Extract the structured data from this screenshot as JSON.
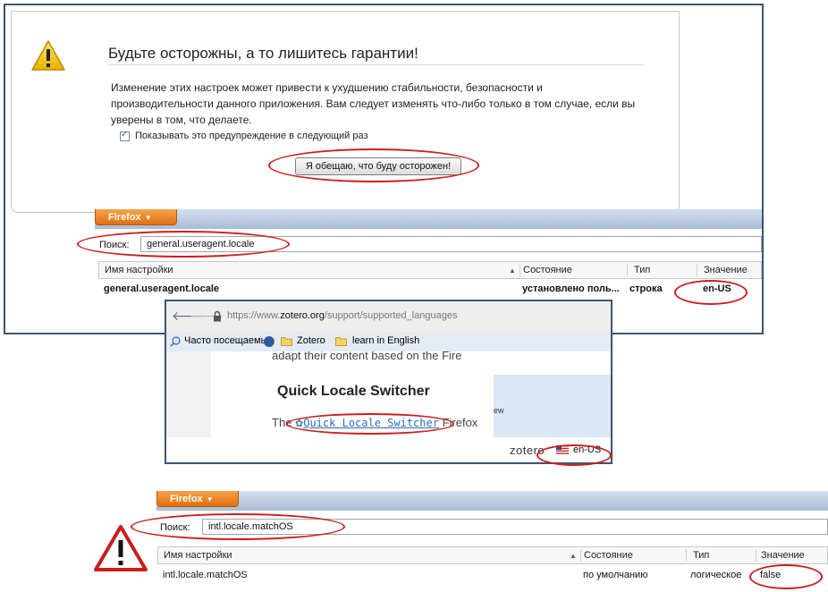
{
  "warning": {
    "title": "Будьте осторожны, а то лишитесь гарантии!",
    "text": "Изменение этих настроек может привести к ухудшению стабильности, безопасности и производительности данного приложения. Вам следует изменять что-либо только в том случае, если вы уверены в том, что делаете.",
    "checkbox_label": "Показывать это предупреждение в следующий раз",
    "checkbox_checked": true,
    "promise_button": "Я обещаю, что буду осторожен!"
  },
  "prefs_top": {
    "app_button": "Firefox",
    "search_label": "Поиск:",
    "search_value": "general.useragent.locale",
    "columns": [
      "Имя настройки",
      "Состояние",
      "Тип",
      "Значение"
    ],
    "row": {
      "name": "general.useragent.locale",
      "status": "установлено поль...",
      "type": "строка",
      "value": "en-US"
    }
  },
  "browser": {
    "url_prefix": "https://www.",
    "url_domain": "zotero.org",
    "url_path": "/support/supported_languages",
    "bookmarks": [
      "Часто посещаемые",
      "Zotero",
      "learn in English"
    ],
    "cut_text_top": "adapt their content based on the Fire",
    "heading": "Quick Locale Switcher",
    "para_start": "The ",
    "link_text": "Quick Locale Switcher",
    "para_end": " Firefox",
    "side_text": "ew",
    "status_brand": "zotero",
    "status_locale": "en-US"
  },
  "prefs_bottom": {
    "app_button": "Firefox",
    "search_label": "Поиск:",
    "search_value": "intl.locale.matchOS",
    "columns": [
      "Имя настройки",
      "Состояние",
      "Тип",
      "Значение"
    ],
    "row": {
      "name": "intl.locale.matchOS",
      "status": "по умолчанию",
      "type": "логическое",
      "value": "false"
    }
  },
  "colors": {
    "highlight": "#cc1f1f",
    "firefox_orange": "#e06f11",
    "frame": "#3a5674"
  }
}
